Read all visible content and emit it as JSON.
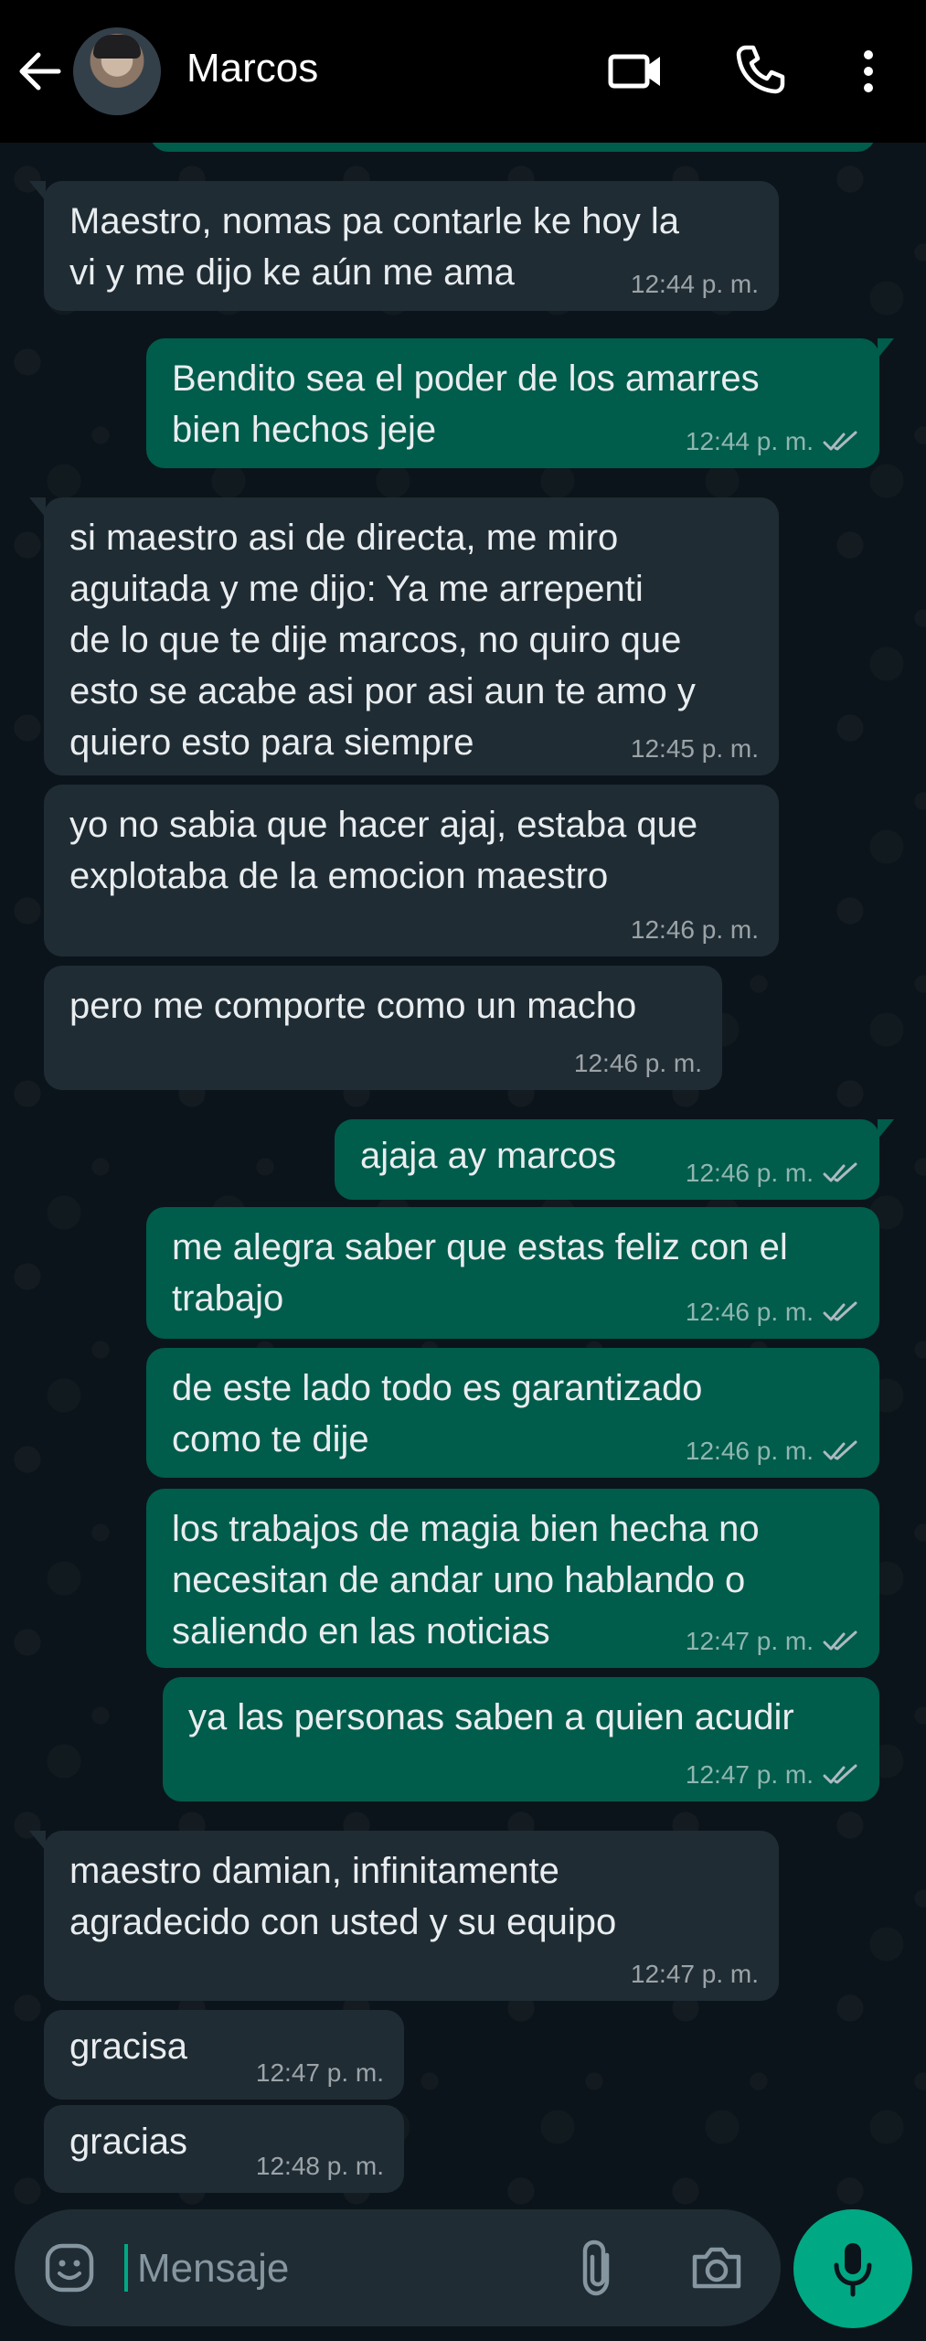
{
  "header": {
    "contact_name": "Marcos",
    "icons": {
      "back": "arrow-left-icon",
      "video": "video-camera-icon",
      "call": "phone-icon",
      "menu": "more-vertical-icon"
    }
  },
  "messages": [
    {
      "dir": "in",
      "text": "Maestro, nomas pa contarle ke hoy la\nvi y me dijo ke aún me ama",
      "time": "12:44 p. m."
    },
    {
      "dir": "out",
      "text": "Bendito sea el poder de los amarres\nbien hechos jeje",
      "time": "12:44 p. m.",
      "status": "read"
    },
    {
      "dir": "in",
      "text": "si maestro asi de directa, me miro\naguitada y me dijo: Ya me arrepenti\nde lo que te dije marcos, no quiro que\nesto se acabe asi por asi aun te amo y\nquiero esto para siempre",
      "time": "12:45 p. m."
    },
    {
      "dir": "in",
      "text": "yo no sabia que hacer ajaj, estaba que\nexplotaba de la emocion maestro",
      "time": "12:46 p. m."
    },
    {
      "dir": "in",
      "text": "pero me comporte como un macho",
      "time": "12:46 p. m."
    },
    {
      "dir": "out",
      "text": "ajaja ay marcos",
      "time": "12:46 p. m.",
      "status": "read"
    },
    {
      "dir": "out",
      "text": "me alegra saber que estas feliz con el\ntrabajo",
      "time": "12:46 p. m.",
      "status": "read"
    },
    {
      "dir": "out",
      "text": "de este lado todo es garantizado\ncomo te dije",
      "time": "12:46 p. m.",
      "status": "read"
    },
    {
      "dir": "out",
      "text": "los trabajos de magia bien hecha no\nnecesitan de andar uno hablando o\nsaliendo en las noticias",
      "time": "12:47 p. m.",
      "status": "read"
    },
    {
      "dir": "out",
      "text": "ya las personas saben a quien acudir",
      "time": "12:47 p. m.",
      "status": "read"
    },
    {
      "dir": "in",
      "text": "maestro damian, infinitamente\nagradecido con usted y su equipo",
      "time": "12:47 p. m."
    },
    {
      "dir": "in",
      "text": "gracisa",
      "time": "12:47 p. m."
    },
    {
      "dir": "in",
      "text": "gracias",
      "time": "12:48 p. m."
    }
  ],
  "composer": {
    "placeholder": "Mensaje",
    "icons": {
      "emoji": "emoji-icon",
      "attach": "paperclip-icon",
      "camera": "camera-icon",
      "mic": "microphone-icon"
    }
  },
  "colors": {
    "background": "#0b141a",
    "incoming_bubble": "#1f2c34",
    "outgoing_bubble": "#005c4b",
    "accent": "#00a884",
    "read_ticks": "#8696a0"
  }
}
